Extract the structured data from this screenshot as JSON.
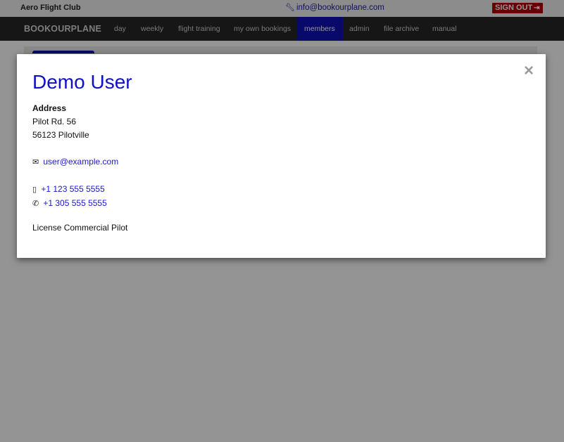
{
  "topbar": {
    "club_name": "Aero Flight Club",
    "contact_email": "info@bookourplane.com",
    "signout_label": "SIGN OUT"
  },
  "nav": {
    "brand": "BOOKOURPLANE",
    "items": [
      {
        "label": "day"
      },
      {
        "label": "weekly"
      },
      {
        "label": "flight training"
      },
      {
        "label": "my own bookings"
      },
      {
        "label": "members",
        "active": true
      },
      {
        "label": "admin"
      },
      {
        "label": "file archive"
      },
      {
        "label": "manual"
      }
    ]
  },
  "modal": {
    "close_symbol": "×",
    "name": "Demo User",
    "address_label": "Address",
    "address_line1": "Pilot Rd. 56",
    "address_line2": "56123 Pilotville",
    "email": "user@example.com",
    "mobile": "+1 123 555 5555",
    "phone": "+1 305 555 5555",
    "license": "License Commercial Pilot"
  },
  "colors": {
    "accent": "#1010b8",
    "signout": "#b0000a",
    "link": "#1a1ac0"
  },
  "icons": {
    "topmail": "wrench-icon",
    "signout": "sign-out-icon",
    "email": "envelope-icon",
    "mobile": "mobile-phone-icon",
    "phone": "phone-icon"
  }
}
